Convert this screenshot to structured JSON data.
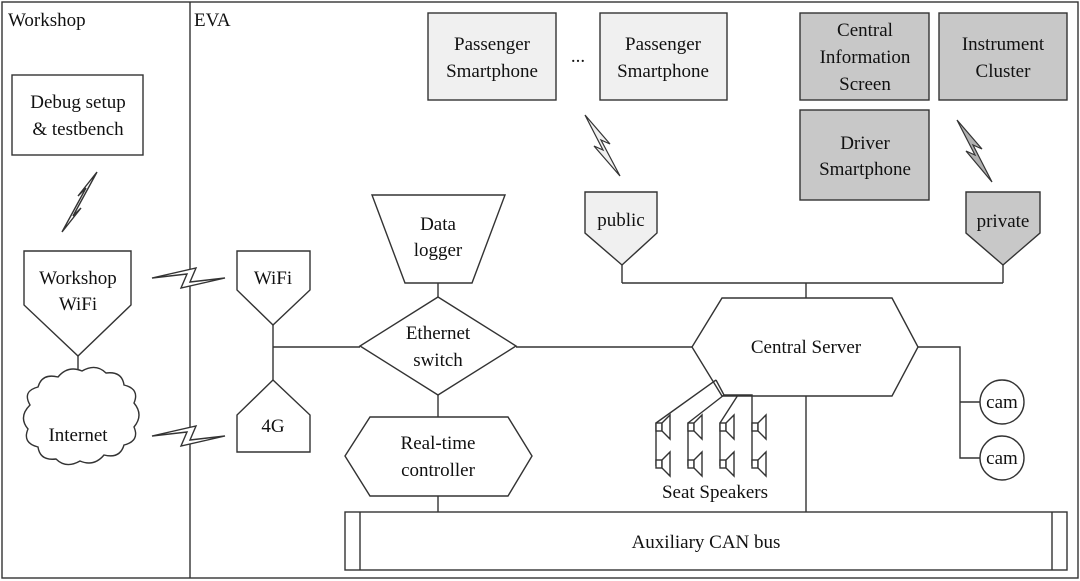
{
  "regions": {
    "workshop": "Workshop",
    "eva": "EVA"
  },
  "nodes": {
    "debug": [
      "Debug setup",
      "& testbench"
    ],
    "workshop_wifi": [
      "Workshop",
      "WiFi"
    ],
    "internet": "Internet",
    "wifi": "WiFi",
    "4g": "4G",
    "data_logger": [
      "Data",
      "logger"
    ],
    "ethernet_switch": [
      "Ethernet",
      "switch"
    ],
    "realtime_controller": [
      "Real-time",
      "controller"
    ],
    "passenger1": [
      "Passenger",
      "Smartphone"
    ],
    "ellipsis": "...",
    "passenger2": [
      "Passenger",
      "Smartphone"
    ],
    "central_info": [
      "Central",
      "Information",
      "Screen"
    ],
    "instrument_cluster": [
      "Instrument",
      "Cluster"
    ],
    "driver_smartphone": [
      "Driver",
      "Smartphone"
    ],
    "public": "public",
    "private": "private",
    "central_server": "Central Server",
    "cam1": "cam",
    "cam2": "cam",
    "seat_speakers": "Seat Speakers",
    "can_bus": "Auxiliary CAN bus"
  },
  "colors": {
    "public_fill": "#f0f0f0",
    "private_fill": "#c8c8c8"
  }
}
